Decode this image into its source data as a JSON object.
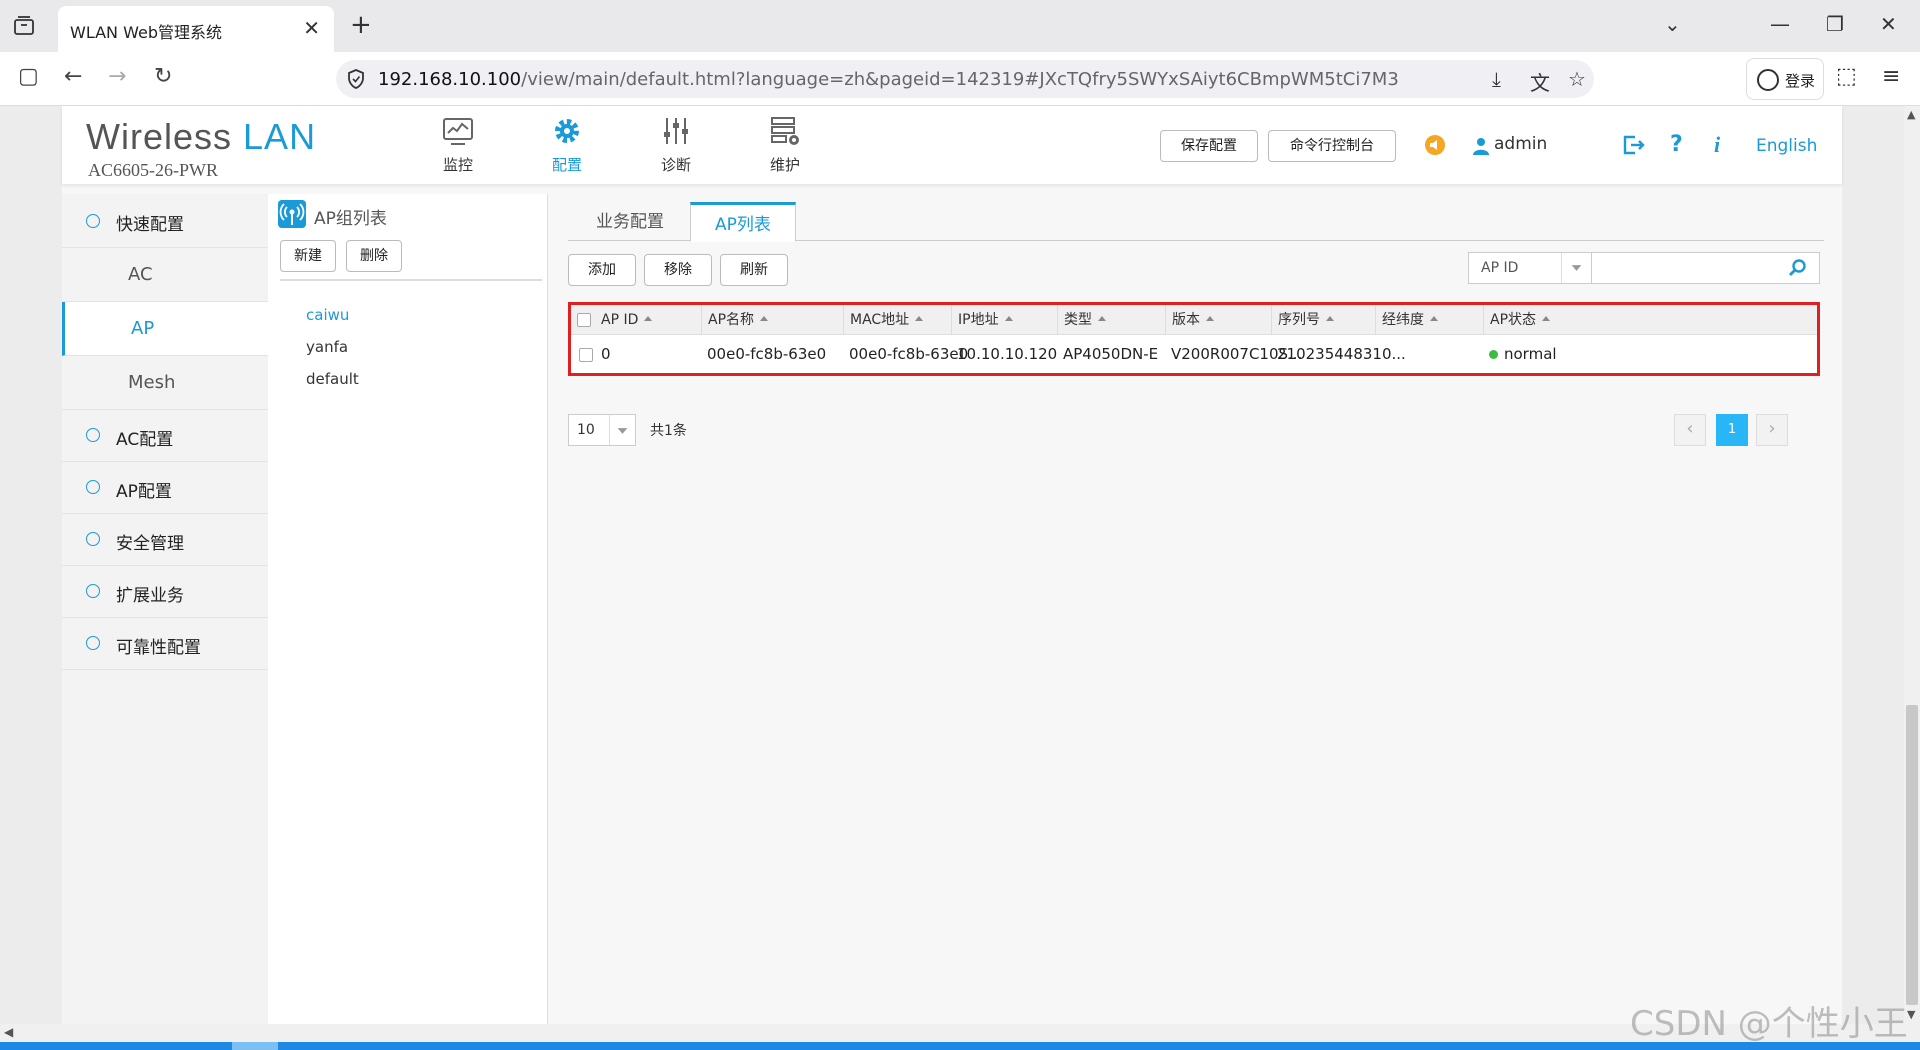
{
  "browser": {
    "tab_title": "WLAN Web管理系统",
    "tab_close": "✕",
    "new_tab": "+",
    "url_host": "192.168.10.100",
    "url_path": "/view/main/default.html?language=zh&pageid=142319#JXcTQfry5SWYxSAiyt6CBmpWM5tCi7M3",
    "login_label": "登录"
  },
  "header": {
    "logo_main": "Wireless",
    "logo_lan": "LAN",
    "model": "AC6605-26-PWR",
    "modules": [
      {
        "label": "监控"
      },
      {
        "label": "配置"
      },
      {
        "label": "诊断"
      },
      {
        "label": "维护"
      }
    ],
    "save_config": "保存配置",
    "cli_console": "命令行控制台",
    "user": "admin",
    "language": "English"
  },
  "sidebar": {
    "quick_config": "快速配置",
    "sub_items": [
      {
        "label": "AC"
      },
      {
        "label": "AP"
      },
      {
        "label": "Mesh"
      }
    ],
    "sections": [
      {
        "label": "AC配置"
      },
      {
        "label": "AP配置"
      },
      {
        "label": "安全管理"
      },
      {
        "label": "扩展业务"
      },
      {
        "label": "可靠性配置"
      }
    ]
  },
  "group_panel": {
    "title": "AP组列表",
    "new_button": "新建",
    "delete_button": "删除",
    "groups": [
      {
        "label": "caiwu"
      },
      {
        "label": "yanfa"
      },
      {
        "label": "default"
      }
    ]
  },
  "main": {
    "tabs": [
      {
        "label": "业务配置"
      },
      {
        "label": "AP列表"
      }
    ],
    "toolbar": {
      "add": "添加",
      "remove": "移除",
      "refresh": "刷新"
    },
    "search": {
      "field": "AP ID",
      "placeholder": ""
    },
    "table": {
      "columns": [
        "AP ID",
        "AP名称",
        "MAC地址",
        "IP地址",
        "类型",
        "版本",
        "序列号",
        "经纬度",
        "AP状态"
      ],
      "rows": [
        {
          "ap_id": "0",
          "ap_name": "00e0-fc8b-63e0",
          "mac": "00e0-fc8b-63e0",
          "ip": "10.10.10.120",
          "type": "AP4050DN-E",
          "version": "V200R007C10S...",
          "serial": "210235448310...",
          "geo": "",
          "status": "normal"
        }
      ]
    },
    "pagination": {
      "page_size": "10",
      "total": "共1条",
      "current_page": "1"
    }
  },
  "watermark": "CSDN @个性小王",
  "colors": {
    "accent": "#1a9ad6",
    "highlight_border": "#e02020",
    "status_ok": "#3cbc3c"
  }
}
